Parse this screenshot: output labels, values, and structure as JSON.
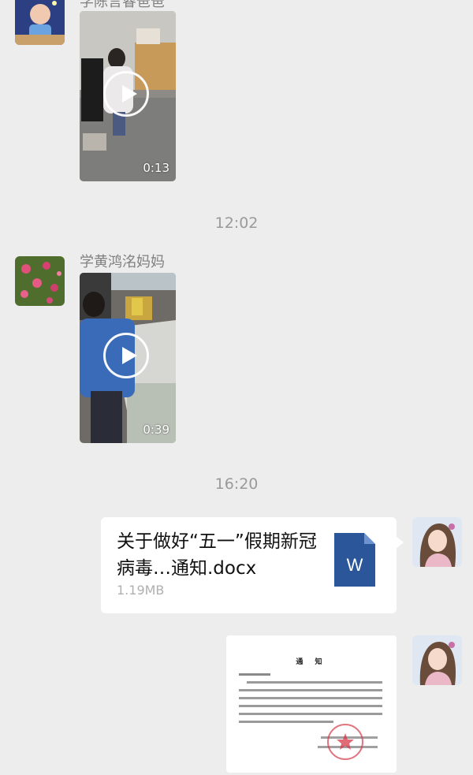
{
  "messages": {
    "first_video": {
      "sender": "学陈言睿爸爸",
      "duration": "0:13"
    },
    "time_1": "12:02",
    "second_video": {
      "sender": "学黄鸿洺妈妈",
      "duration": "0:39"
    },
    "time_2": "16:20",
    "file": {
      "title": "关于做好“五一”假期新冠病毒…通知.docx",
      "size": "1.19MB",
      "icon_letter": "W"
    },
    "document_image": {
      "title": "通 知"
    }
  }
}
